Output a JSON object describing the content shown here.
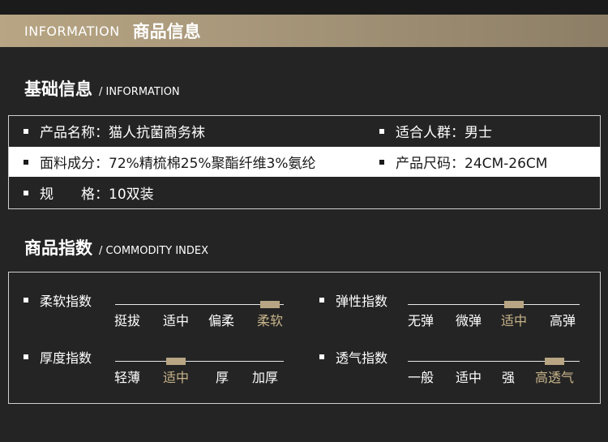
{
  "header": {
    "en": "INFORMATION",
    "cn": "商品信息"
  },
  "basic": {
    "title_cn": "基础信息",
    "title_en": "/ INFORMATION",
    "rows": [
      {
        "left": "产品名称：猫人抗菌商务袜",
        "right": "适合人群：男士"
      },
      {
        "left": "面料成分：72%精梳棉25%聚酯纤维3%氨纶",
        "right": "产品尺码：24CM-26CM"
      },
      {
        "left": "规　　格：10双装",
        "right": ""
      }
    ]
  },
  "commodity": {
    "title_cn": "商品指数",
    "title_en": "/ COMMODITY INDEX",
    "indices": [
      {
        "label": "柔软指数",
        "options": [
          "挺拔",
          "适中",
          "偏柔",
          "柔软"
        ],
        "selected": 3
      },
      {
        "label": "弹性指数",
        "options": [
          "无弹",
          "微弹",
          "适中",
          "高弹"
        ],
        "selected": 2
      },
      {
        "label": "厚度指数",
        "options": [
          "轻薄",
          "适中",
          "厚",
          "加厚"
        ],
        "selected": 1
      },
      {
        "label": "透气指数",
        "options": [
          "一般",
          "适中",
          "强",
          "高透气"
        ],
        "selected": 3
      }
    ]
  },
  "colors": {
    "accent": "#b7a583",
    "background": "#242424"
  }
}
